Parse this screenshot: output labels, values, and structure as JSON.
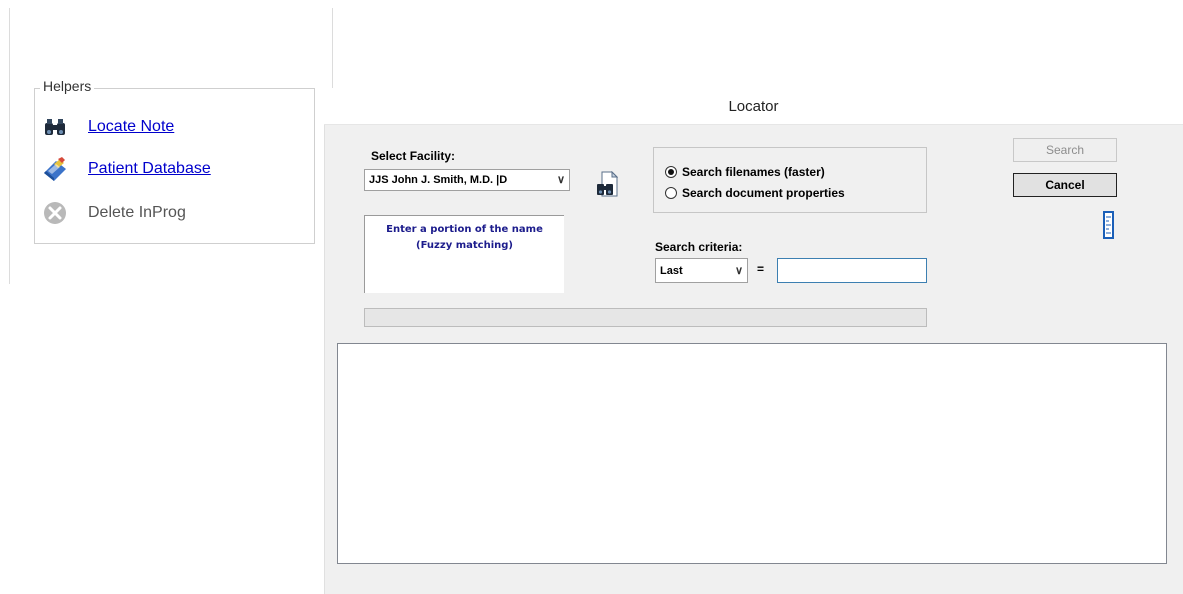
{
  "helpers": {
    "legend": "Helpers",
    "items": [
      {
        "label": "Locate Note",
        "icon": "binoculars-icon",
        "enabled": true
      },
      {
        "label": "Patient Database",
        "icon": "database-book-icon",
        "enabled": true
      },
      {
        "label": "Delete InProg",
        "icon": "delete-circle-icon",
        "enabled": false
      }
    ]
  },
  "dialog": {
    "title": "Locator",
    "facility": {
      "label": "Select Facility:",
      "selected": "JJS  John J. Smith, M.D. |D"
    },
    "hint": {
      "line1": "Enter a portion of the name",
      "line2": "(Fuzzy matching)"
    },
    "search_mode": {
      "options": [
        {
          "label": "Search filenames (faster)",
          "checked": true
        },
        {
          "label": "Search document properties",
          "checked": false
        }
      ]
    },
    "criteria": {
      "label": "Search criteria:",
      "field_selected": "Last",
      "equals": "=",
      "value": ""
    },
    "buttons": {
      "search": "Search",
      "cancel": "Cancel"
    }
  },
  "colors": {
    "link": "#0000cc",
    "dialog_bg": "#f0f0f0",
    "hint_text": "#1c1c8c",
    "input_border": "#3c7fb1"
  }
}
